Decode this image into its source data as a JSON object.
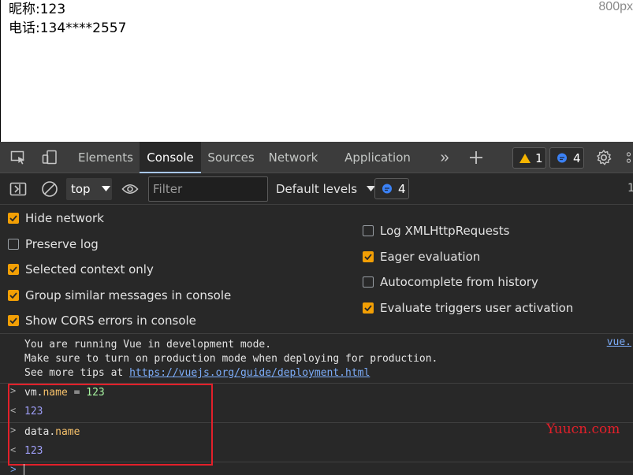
{
  "page": {
    "lines": [
      "昵称:123",
      "电话:134****2557"
    ],
    "size_label": "800px"
  },
  "devtools": {
    "tabs": [
      {
        "label": "Elements",
        "active": false
      },
      {
        "label": "Console",
        "active": true
      },
      {
        "label": "Sources",
        "active": false
      },
      {
        "label": "Network",
        "active": false
      },
      {
        "label": "Application",
        "active": false
      }
    ],
    "badges": {
      "warnings": "1",
      "messages": "4"
    },
    "toolbar": {
      "context": "top",
      "filter_placeholder": "Filter",
      "levels": "Default levels",
      "issues": "4",
      "right_count": "1"
    },
    "settings": {
      "left": [
        {
          "label": "Hide network",
          "checked": true
        },
        {
          "label": "Preserve log",
          "checked": false
        },
        {
          "label": "Selected context only",
          "checked": true
        },
        {
          "label": "Group similar messages in console",
          "checked": true
        },
        {
          "label": "Show CORS errors in console",
          "checked": true
        }
      ],
      "right": [
        {
          "label": "Log XMLHttpRequests",
          "checked": false
        },
        {
          "label": "Eager evaluation",
          "checked": true
        },
        {
          "label": "Autocomplete from history",
          "checked": false
        },
        {
          "label": "Evaluate triggers user activation",
          "checked": true
        }
      ]
    },
    "console": {
      "vue_message": {
        "line1": "You are running Vue in development mode.",
        "line2": "Make sure to turn on production mode when deploying for production.",
        "line3_prefix": "See more tips at ",
        "link": "https://vuejs.org/guide/deployment.html",
        "source": "vue."
      },
      "entries": [
        {
          "kind": "input",
          "obj": "vm",
          "prop": "name",
          "rest": " = ",
          "value": "123"
        },
        {
          "kind": "output",
          "value": "123"
        },
        {
          "kind": "input",
          "obj": "data",
          "prop": "name",
          "rest": "",
          "value": ""
        },
        {
          "kind": "output",
          "value": "123"
        }
      ]
    },
    "watermark": "Yuucn.com"
  }
}
